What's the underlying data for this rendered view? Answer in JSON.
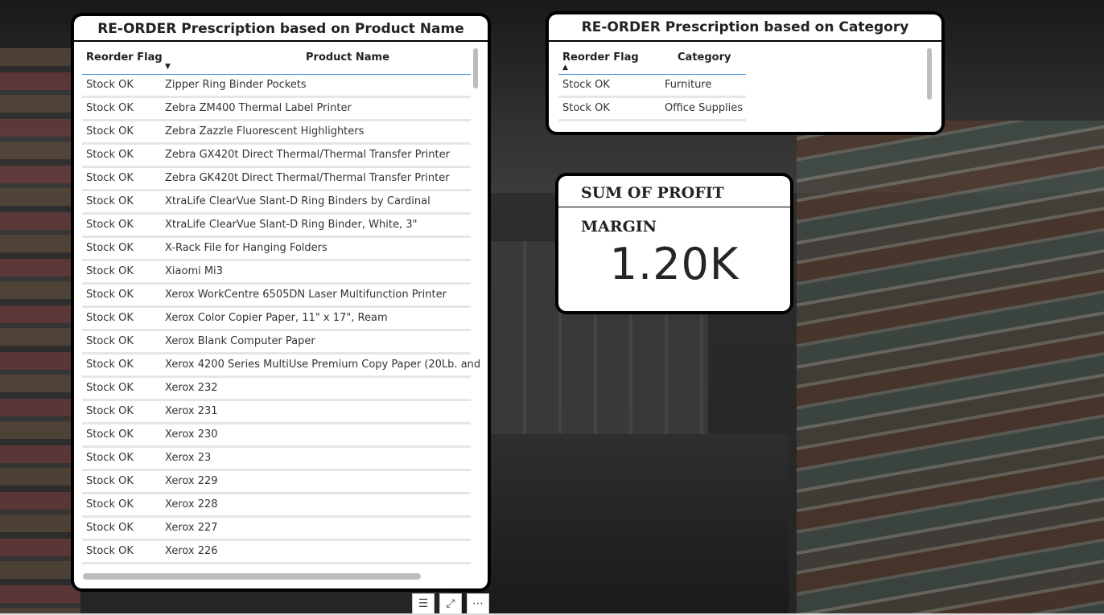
{
  "products_table": {
    "title": "RE-ORDER Prescription based on Product Name",
    "columns": [
      "Reorder Flag",
      "Product Name"
    ],
    "sort_column": "Reorder Flag",
    "sort_direction": "descending",
    "rows": [
      [
        "Stock OK",
        "Zipper Ring Binder Pockets"
      ],
      [
        "Stock OK",
        "Zebra ZM400 Thermal Label Printer"
      ],
      [
        "Stock OK",
        "Zebra Zazzle Fluorescent Highlighters"
      ],
      [
        "Stock OK",
        "Zebra GX420t Direct Thermal/Thermal Transfer Printer"
      ],
      [
        "Stock OK",
        "Zebra GK420t Direct Thermal/Thermal Transfer Printer"
      ],
      [
        "Stock OK",
        "XtraLife ClearVue Slant-D Ring Binders by Cardinal"
      ],
      [
        "Stock OK",
        "XtraLife ClearVue Slant-D Ring Binder, White, 3\""
      ],
      [
        "Stock OK",
        "X-Rack File for Hanging Folders"
      ],
      [
        "Stock OK",
        "Xiaomi Mi3"
      ],
      [
        "Stock OK",
        "Xerox WorkCentre 6505DN Laser Multifunction Printer"
      ],
      [
        "Stock OK",
        "Xerox Color Copier Paper, 11\" x 17\", Ream"
      ],
      [
        "Stock OK",
        "Xerox Blank Computer Paper"
      ],
      [
        "Stock OK",
        "Xerox 4200 Series MultiUse Premium Copy Paper (20Lb. and"
      ],
      [
        "Stock OK",
        "Xerox 232"
      ],
      [
        "Stock OK",
        "Xerox 231"
      ],
      [
        "Stock OK",
        "Xerox 230"
      ],
      [
        "Stock OK",
        "Xerox 23"
      ],
      [
        "Stock OK",
        "Xerox 229"
      ],
      [
        "Stock OK",
        "Xerox 228"
      ],
      [
        "Stock OK",
        "Xerox 227"
      ],
      [
        "Stock OK",
        "Xerox 226"
      ]
    ]
  },
  "category_table": {
    "title": "RE-ORDER Prescription based on Category",
    "columns": [
      "Reorder Flag",
      "Category"
    ],
    "sort_column": "Reorder Flag",
    "sort_direction": "ascending",
    "rows": [
      [
        "Stock OK",
        "Furniture"
      ],
      [
        "Stock OK",
        "Office Supplies"
      ]
    ]
  },
  "kpi": {
    "title": "SUM OF PROFIT MARGIN",
    "value": "1.20K"
  },
  "visual_header": {
    "buttons": [
      "filter-icon",
      "focus-mode-icon",
      "more-options-icon"
    ],
    "filter_glyph": "☰",
    "focus_glyph": "⤢",
    "more_glyph": "⋯"
  },
  "colors": {
    "accent_underline": "#3b8fd8",
    "card_border": "#000000",
    "scrollbar": "#bdbdbd"
  }
}
